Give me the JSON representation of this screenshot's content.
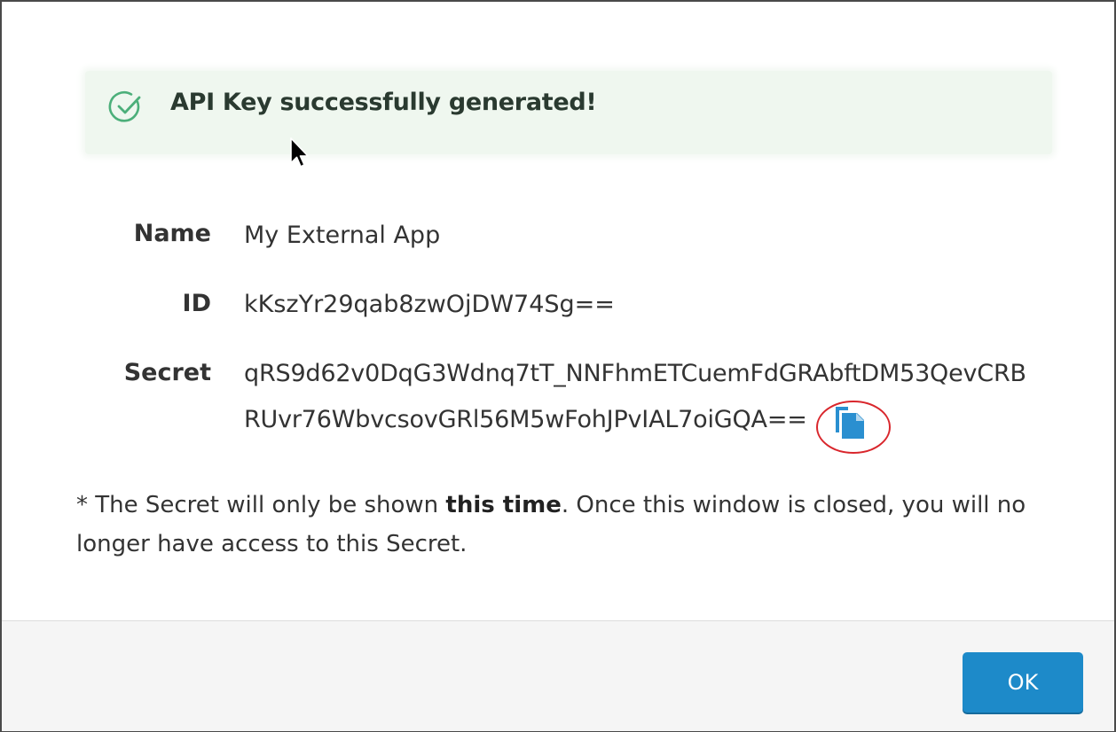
{
  "banner": {
    "message": "API Key successfully generated!",
    "icon": "check-circle-icon",
    "icon_color": "#4caf7a",
    "background": "#eff7ef"
  },
  "fields": {
    "name_label": "Name",
    "name_value": "My External App",
    "id_label": "ID",
    "id_value": "kKszYr29qab8zwOjDW74Sg==",
    "secret_label": "Secret",
    "secret_line1": "qRS9d62v0DqG3Wdnq7tT_NNFhmETCuemFdGRAbftDM53QevCRB",
    "secret_line2": "RUvr76WbvcsovGRl56M5wFohJPvIAL7oiGQA=="
  },
  "copy_button": {
    "icon": "copy-icon",
    "color": "#2a8fd0",
    "highlight_color": "#d9262c"
  },
  "note": {
    "prefix": "* The Secret will only be shown ",
    "emphasis": "this time",
    "suffix": ". Once this window is closed, you will no longer have access to this Secret."
  },
  "footer": {
    "ok_label": "OK",
    "ok_color": "#1d8ac9"
  }
}
